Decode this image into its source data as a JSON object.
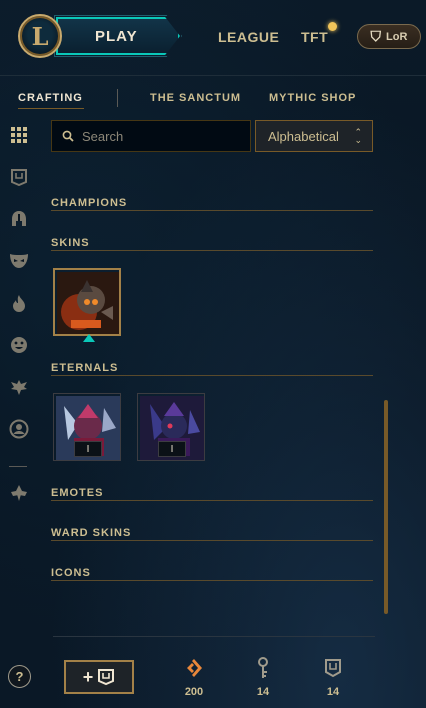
{
  "topbar": {
    "play_label": "PLAY",
    "nav": [
      "LEAGUE",
      "TFT"
    ],
    "lor_label": "LoR"
  },
  "tabs": [
    "CRAFTING",
    "THE SANCTUM",
    "MYTHIC SHOP"
  ],
  "search": {
    "placeholder": "Search"
  },
  "sort": {
    "selected": "Alphabetical"
  },
  "categories": {
    "champions": "CHAMPIONS",
    "skins": "SKINS",
    "eternals": "ETERNALS",
    "emotes": "EMOTES",
    "ward_skins": "WARD SKINS",
    "icons": "ICONS"
  },
  "eternals": [
    {
      "tier": "I"
    },
    {
      "tier": "I"
    }
  ],
  "footer": {
    "help": "?",
    "add_plus": "+",
    "currencies": [
      {
        "icon": "orange-essence-icon",
        "value": "200"
      },
      {
        "icon": "key-icon",
        "value": "14"
      },
      {
        "icon": "chest-icon",
        "value": "14"
      }
    ]
  },
  "colors": {
    "gold": "#c8aa6e",
    "teal": "#0ac8b9",
    "orange": "#e8873a"
  }
}
